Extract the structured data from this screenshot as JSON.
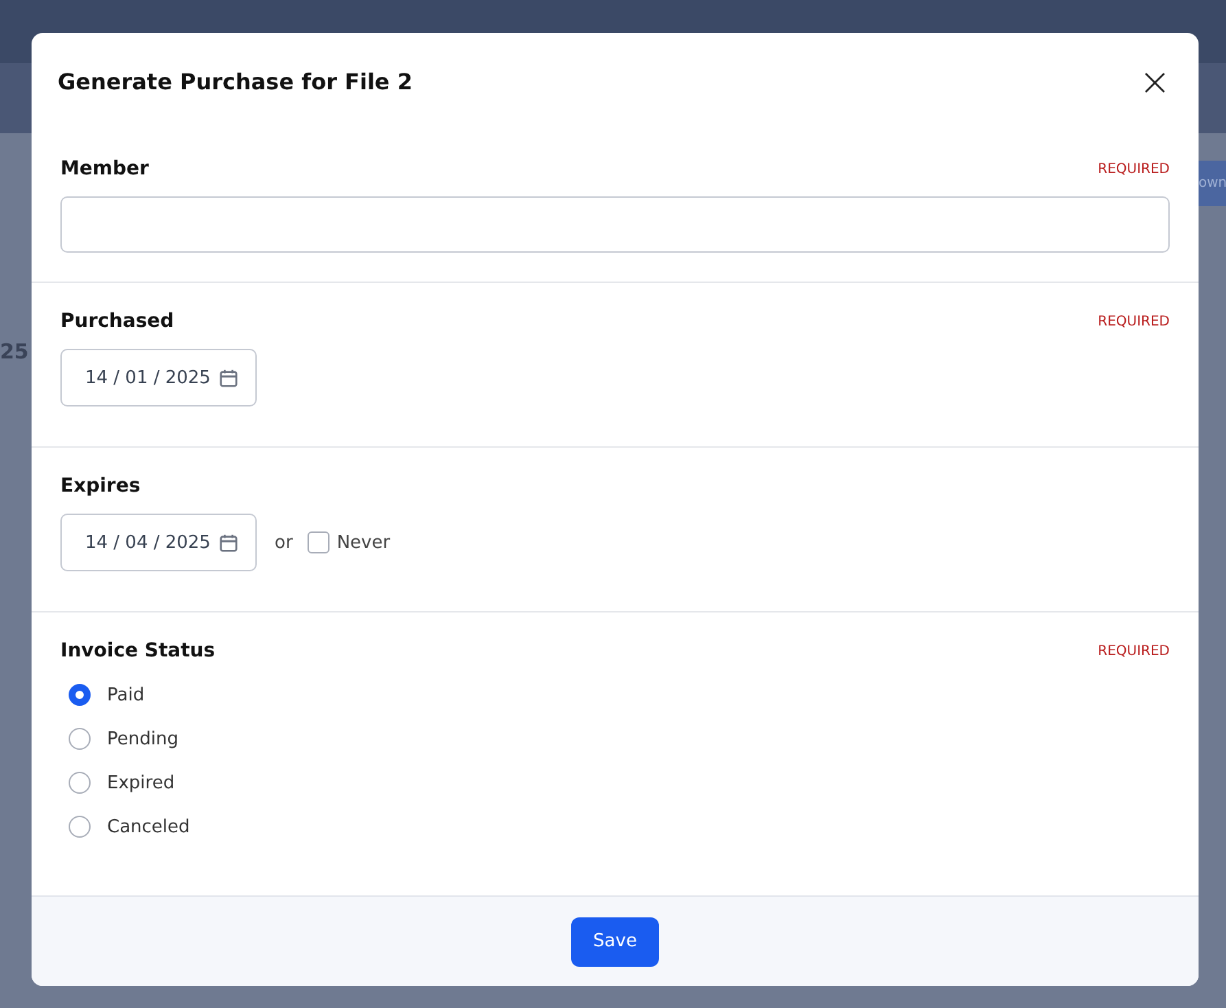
{
  "backdrop": {
    "button_fragment": "own",
    "text_fragment": "25"
  },
  "dialog": {
    "title": "Generate Purchase for File 2",
    "close": "×"
  },
  "fields": [
    {
      "kind": "text",
      "label": "Member",
      "required_text": "REQUIRED"
    },
    {
      "kind": "date",
      "label": "Purchased",
      "required_text": "REQUIRED",
      "value": "14 / 01 / 2025"
    },
    {
      "kind": "date",
      "label": "Expires",
      "value": "14 / 04 / 2025",
      "or_text": "or",
      "never": {
        "label": "Never",
        "checked": false
      }
    },
    {
      "kind": "radio",
      "label": "Invoice Status",
      "required_text": "REQUIRED",
      "options": [
        {
          "label": "Paid",
          "selected": true
        },
        {
          "label": "Pending",
          "selected": false
        },
        {
          "label": "Expired",
          "selected": false
        },
        {
          "label": "Canceled",
          "selected": false
        }
      ]
    }
  ],
  "footer": {
    "save": "Save"
  }
}
